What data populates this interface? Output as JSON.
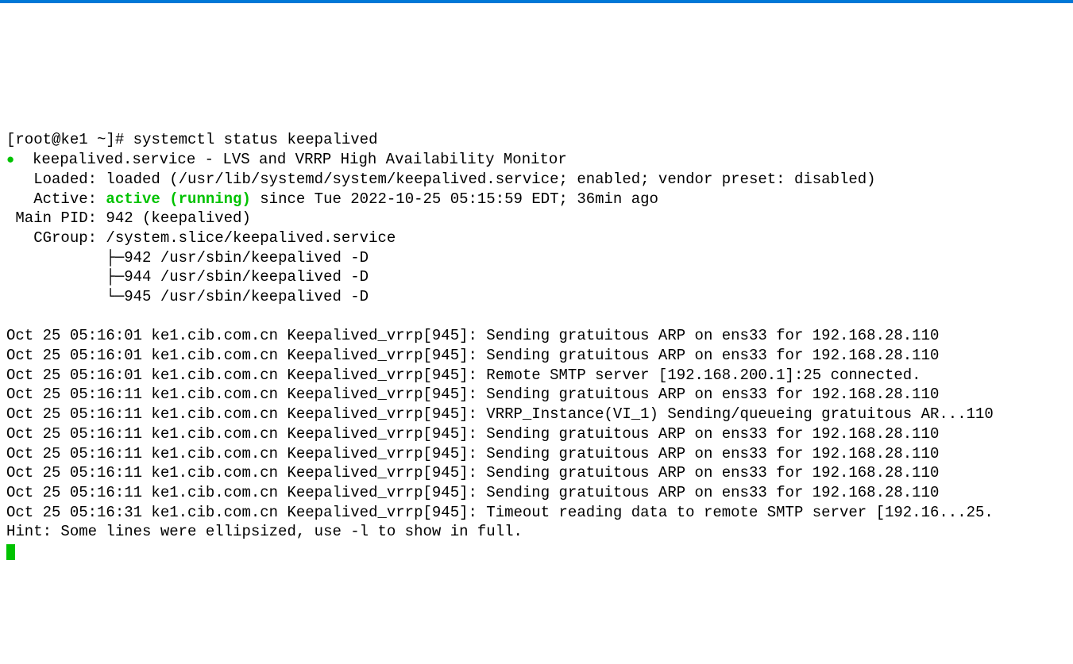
{
  "prompt": "[root@ke1 ~]# ",
  "command": "systemctl status keepalived",
  "status": {
    "bullet": "●",
    "service_line": "  keepalived.service - LVS and VRRP High Availability Monitor",
    "loaded_line": "   Loaded: loaded (/usr/lib/systemd/system/keepalived.service; enabled; vendor preset: disabled)",
    "active_prefix": "   Active: ",
    "active_state": "active (running)",
    "active_suffix": " since Tue 2022-10-25 05:15:59 EDT; 36min ago",
    "main_pid_line": " Main PID: 942 (keepalived)",
    "cgroup_line": "   CGroup: /system.slice/keepalived.service",
    "tree1_prefix": "           ├─",
    "tree1_text": "942 /usr/sbin/keepalived -D",
    "tree2_prefix": "           ├─",
    "tree2_text": "944 /usr/sbin/keepalived -D",
    "tree3_prefix": "           └─",
    "tree3_text": "945 /usr/sbin/keepalived -D"
  },
  "logs": [
    "Oct 25 05:16:01 ke1.cib.com.cn Keepalived_vrrp[945]: Sending gratuitous ARP on ens33 for 192.168.28.110",
    "Oct 25 05:16:01 ke1.cib.com.cn Keepalived_vrrp[945]: Sending gratuitous ARP on ens33 for 192.168.28.110",
    "Oct 25 05:16:01 ke1.cib.com.cn Keepalived_vrrp[945]: Remote SMTP server [192.168.200.1]:25 connected.",
    "Oct 25 05:16:11 ke1.cib.com.cn Keepalived_vrrp[945]: Sending gratuitous ARP on ens33 for 192.168.28.110",
    "Oct 25 05:16:11 ke1.cib.com.cn Keepalived_vrrp[945]: VRRP_Instance(VI_1) Sending/queueing gratuitous AR...110",
    "Oct 25 05:16:11 ke1.cib.com.cn Keepalived_vrrp[945]: Sending gratuitous ARP on ens33 for 192.168.28.110",
    "Oct 25 05:16:11 ke1.cib.com.cn Keepalived_vrrp[945]: Sending gratuitous ARP on ens33 for 192.168.28.110",
    "Oct 25 05:16:11 ke1.cib.com.cn Keepalived_vrrp[945]: Sending gratuitous ARP on ens33 for 192.168.28.110",
    "Oct 25 05:16:11 ke1.cib.com.cn Keepalived_vrrp[945]: Sending gratuitous ARP on ens33 for 192.168.28.110",
    "Oct 25 05:16:31 ke1.cib.com.cn Keepalived_vrrp[945]: Timeout reading data to remote SMTP server [192.16...25."
  ],
  "hint": "Hint: Some lines were ellipsized, use -l to show in full.",
  "next_prompt_partial": ""
}
